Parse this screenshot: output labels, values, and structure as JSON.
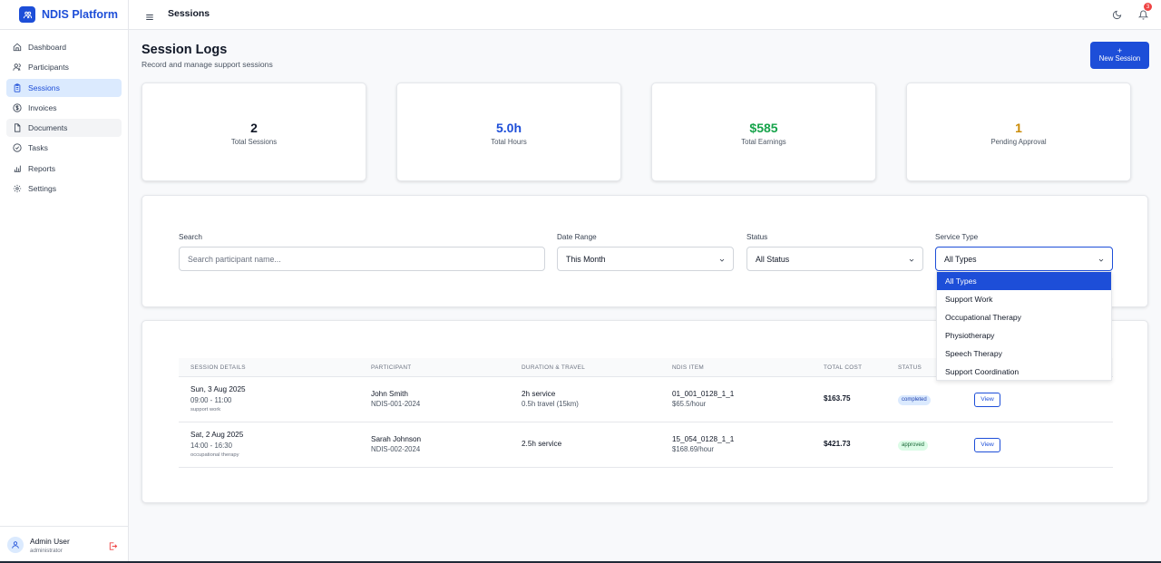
{
  "brand": {
    "name": "NDIS Platform"
  },
  "sidebar": {
    "items": [
      {
        "label": "Dashboard",
        "icon": "home-icon"
      },
      {
        "label": "Participants",
        "icon": "users-icon"
      },
      {
        "label": "Sessions",
        "icon": "clipboard-icon"
      },
      {
        "label": "Invoices",
        "icon": "dollar-icon"
      },
      {
        "label": "Documents",
        "icon": "file-icon"
      },
      {
        "label": "Tasks",
        "icon": "check-circle-icon"
      },
      {
        "label": "Reports",
        "icon": "bar-chart-icon"
      },
      {
        "label": "Settings",
        "icon": "gear-icon"
      }
    ],
    "active": "Sessions"
  },
  "user": {
    "name": "Admin User",
    "role": "administrator"
  },
  "topbar": {
    "title": "Sessions",
    "notifications": "3"
  },
  "page": {
    "title": "Session Logs",
    "subtitle": "Record and manage support sessions",
    "new_button_icon": "+",
    "new_button": "New Session"
  },
  "stats": [
    {
      "value": "2",
      "label": "Total Sessions",
      "color": "#111827"
    },
    {
      "value": "5.0h",
      "label": "Total Hours",
      "color": "#1d4ed8"
    },
    {
      "value": "$585",
      "label": "Total Earnings",
      "color": "#16a34a"
    },
    {
      "value": "1",
      "label": "Pending Approval",
      "color": "#ca8a04"
    }
  ],
  "filters": {
    "search_label": "Search",
    "search_placeholder": "Search participant name...",
    "date_label": "Date Range",
    "date_value": "This Month",
    "status_label": "Status",
    "status_value": "All Status",
    "service_label": "Service Type",
    "service_value": "All Types",
    "service_options": [
      "All Types",
      "Support Work",
      "Occupational Therapy",
      "Physiotherapy",
      "Speech Therapy",
      "Support Coordination"
    ]
  },
  "table": {
    "headers": [
      "SESSION DETAILS",
      "PARTICIPANT",
      "DURATION & TRAVEL",
      "NDIS ITEM",
      "TOTAL COST",
      "STATUS"
    ],
    "rows": [
      {
        "date": "Sun, 3 Aug 2025",
        "time": "09:00 - 11:00",
        "type": "support work",
        "participant": "John Smith",
        "pid": "NDIS-001-2024",
        "duration": "2h service",
        "travel": "0.5h travel (15km)",
        "item": "01_001_0128_1_1",
        "rate": "$65.5/hour",
        "cost": "$163.75",
        "status": "completed",
        "view": "View"
      },
      {
        "date": "Sat, 2 Aug 2025",
        "time": "14:00 - 16:30",
        "type": "occupational therapy",
        "participant": "Sarah Johnson",
        "pid": "NDIS-002-2024",
        "duration": "2.5h service",
        "travel": "",
        "item": "15_054_0128_1_1",
        "rate": "$168.69/hour",
        "cost": "$421.73",
        "status": "approved",
        "view": "View"
      }
    ]
  }
}
